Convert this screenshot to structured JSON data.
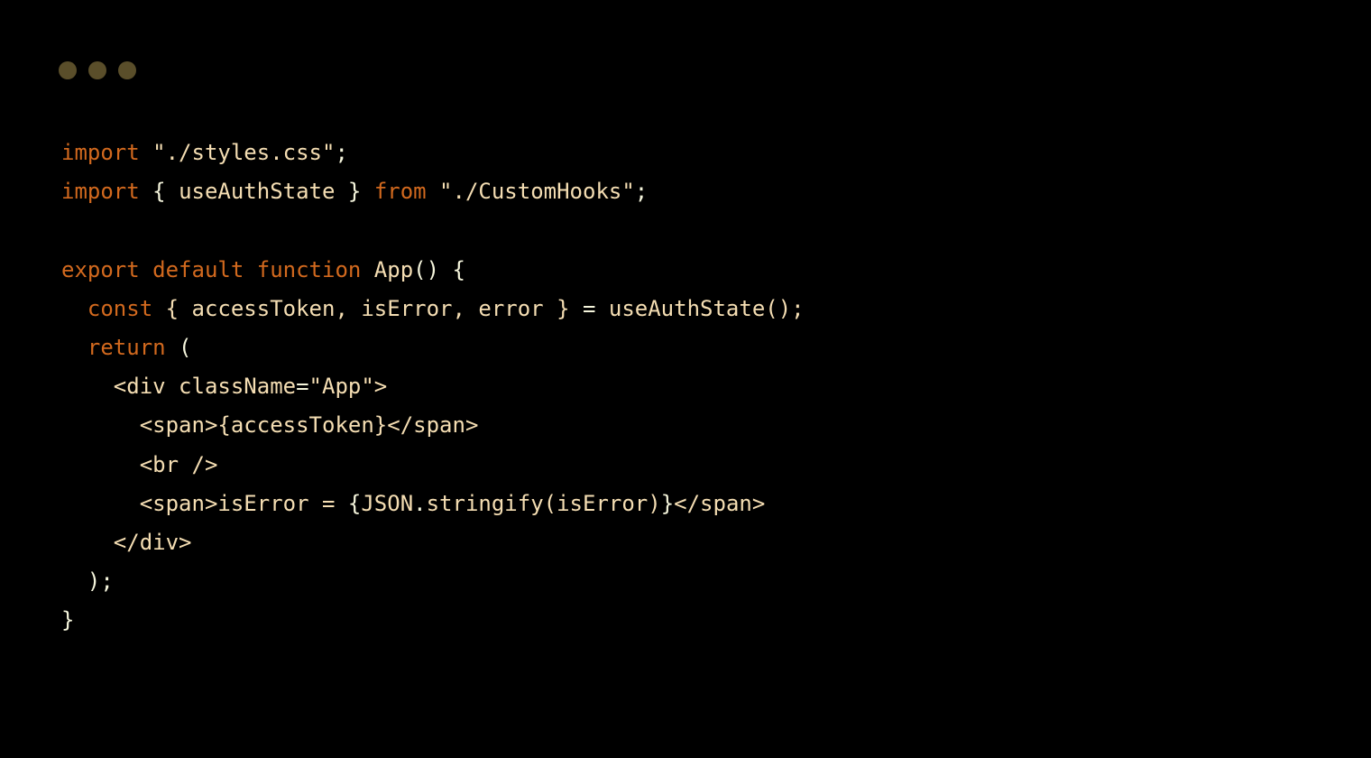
{
  "code": {
    "line1": {
      "import": "import",
      "string": "\"./styles.css\"",
      "semi": ";"
    },
    "line2": {
      "import": "import",
      "lbrace": " { ",
      "ident": "useAuthState",
      "rbrace": " } ",
      "from": "from",
      "string": " \"./CustomHooks\"",
      "semi": ";"
    },
    "line4": {
      "export": "export",
      "default": " default",
      "function": " function",
      "name": " App",
      "parens": "()",
      "lbrace": " {"
    },
    "line5": {
      "indent": "  ",
      "const": "const",
      "destruct": " { accessToken, isError, error } ",
      "eq": "=",
      "call": " useAuthState();"
    },
    "line6": {
      "indent": "  ",
      "return": "return",
      "paren": " ("
    },
    "line7": {
      "indent": "    ",
      "open": "<div",
      "attr": " className",
      "eq": "=",
      "val": "\"App\"",
      "close": ">"
    },
    "line8": {
      "indent": "      ",
      "open": "<span>",
      "expr": "{accessToken}",
      "closeTag": "</span>"
    },
    "line9": {
      "indent": "      ",
      "br": "<br />"
    },
    "line10": {
      "indent": "      ",
      "open": "<span>",
      "text": "isError = ",
      "exprOpen": "{",
      "json": "JSON",
      "dot": ".",
      "method": "stringify",
      "arg": "(isError)",
      "exprClose": "}",
      "closeTag": "</span>"
    },
    "line11": {
      "indent": "    ",
      "closediv": "</div>"
    },
    "line12": {
      "indent": "  ",
      "paren": ");"
    },
    "line13": {
      "brace": "}"
    }
  }
}
